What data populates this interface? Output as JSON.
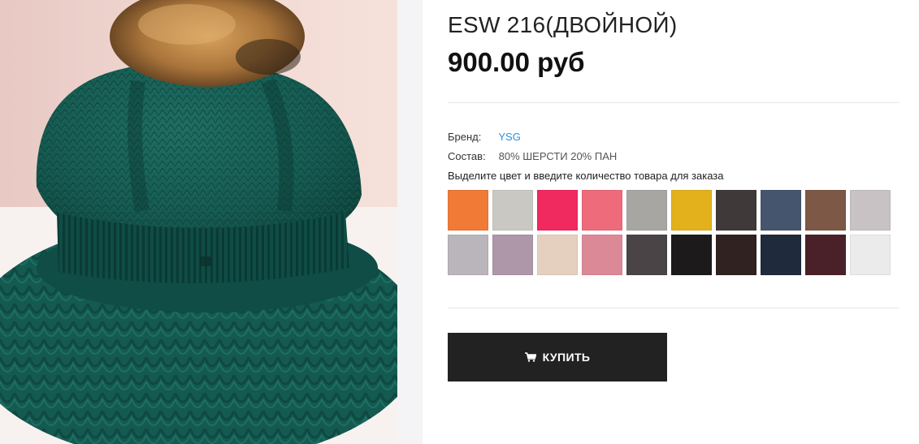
{
  "product": {
    "title": "ESW 216(ДВОЙНОЙ)",
    "price": "900.00 руб"
  },
  "attributes": {
    "brand_label": "Бренд:",
    "brand_value": "YSG",
    "composition_label": "Состав:",
    "composition_value": "80% ШЕРСТИ 20% ПАН"
  },
  "color_hint": "Выделите цвет и введите количество товара для заказа",
  "swatches": [
    "#f07a36",
    "#c9c8c2",
    "#f0295f",
    "#ee6b7c",
    "#a7a6a3",
    "#e2b11c",
    "#3f3a39",
    "#45556e",
    "#7d5846",
    "#c8c2c4",
    "#b9b5bb",
    "#ad97a9",
    "#e5d0bf",
    "#dc8997",
    "#4a4446",
    "#1c1a1b",
    "#2f2221",
    "#1f2b3c",
    "#4a2129",
    "#ecebeb"
  ],
  "buy_button": {
    "label": "КУПИТЬ",
    "icon": "cart-icon"
  },
  "colors": {
    "button_bg": "#222222",
    "link": "#2f8fd8",
    "photo_pane_bg": "#f4f4f6"
  }
}
